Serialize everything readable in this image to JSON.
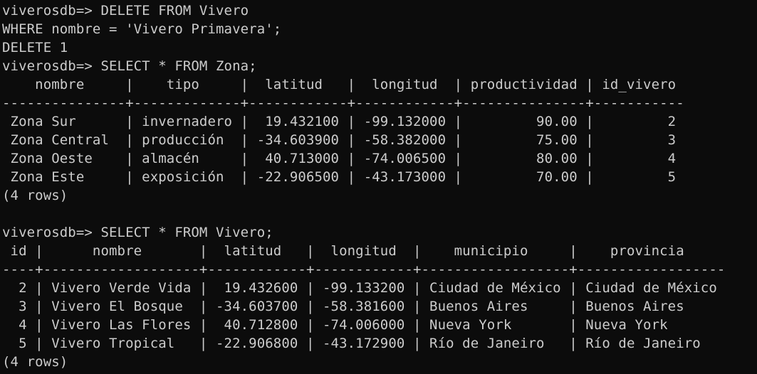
{
  "terminal": {
    "background": "#0c0c0c",
    "foreground": "#cccccc",
    "lines": [
      "viverosdb=> DELETE FROM Vivero",
      "WHERE nombre = 'Vivero Primavera';",
      "DELETE 1",
      "viverosdb=> SELECT * FROM Zona;",
      "    nombre     |    tipo     |  latitud   |  longitud  | productividad | id_vivero",
      "---------------+-------------+------------+------------+---------------+-----------",
      " Zona Sur      | invernadero |  19.432100 | -99.132000 |         90.00 |         2",
      " Zona Central  | producción  | -34.603900 | -58.382000 |         75.00 |         3",
      " Zona Oeste    | almacén     |  40.713000 | -74.006500 |         80.00 |         4",
      " Zona Este     | exposición  | -22.906500 | -43.173000 |         70.00 |         5",
      "(4 rows)",
      "",
      "viverosdb=> SELECT * FROM Vivero;",
      " id |      nombre       |  latitud   |  longitud  |    municipio     |    provincia",
      "----+-------------------+------------+------------+------------------+------------------",
      "  2 | Vivero Verde Vida |  19.432600 | -99.133200 | Ciudad de México | Ciudad de México",
      "  3 | Vivero El Bosque  | -34.603700 | -58.381600 | Buenos Aires     | Buenos Aires",
      "  4 | Vivero Las Flores |  40.712800 | -74.006000 | Nueva York       | Nueva York",
      "  5 | Vivero Tropical   | -22.906800 | -43.172900 | Río de Janeiro   | Río de Janeiro",
      "(4 rows)"
    ]
  }
}
